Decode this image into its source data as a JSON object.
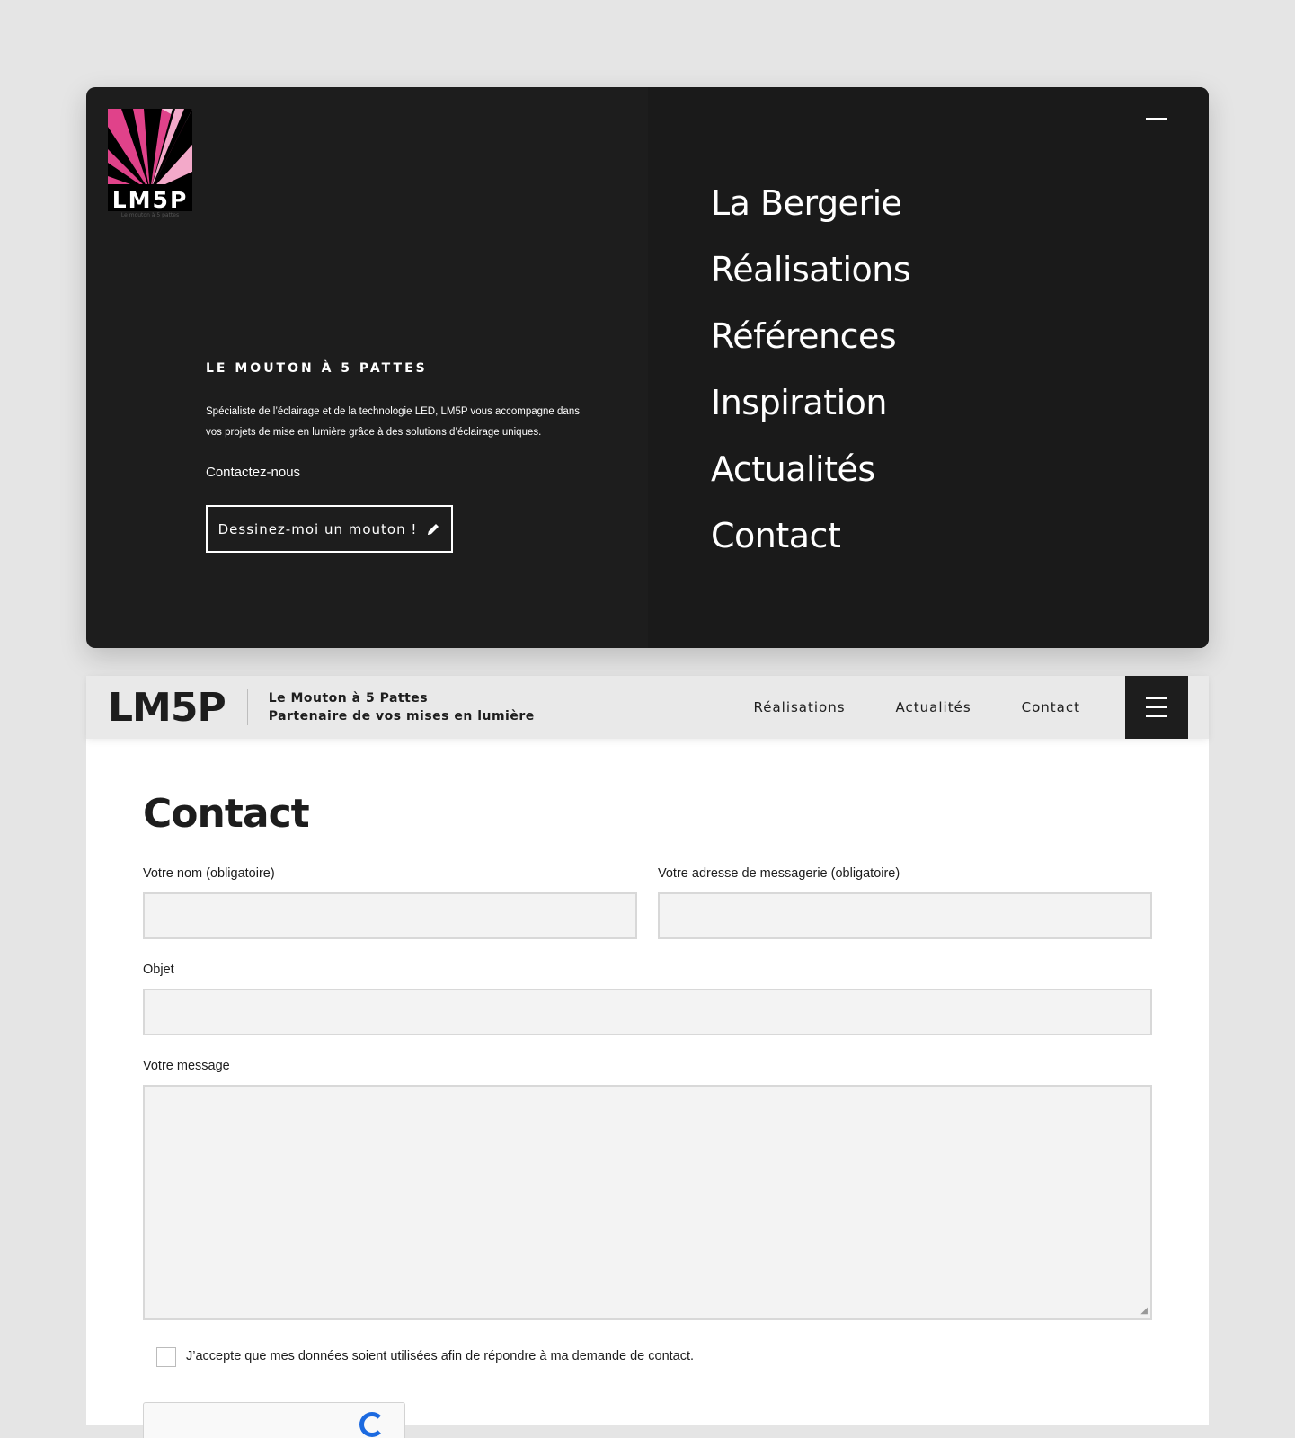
{
  "menu_overlay": {
    "logo": {
      "letters": "LM5P",
      "tag": "Le mouton à 5 pattes",
      "colors": [
        "#e0428a",
        "#f3a9c9",
        "#000000"
      ]
    },
    "brand_title": "LE MOUTON À 5 PATTES",
    "description": "Spécialiste de l’éclairage et de la technologie LED, LM5P vous accompagne dans vos projets de mise en lumière grâce à des solutions d’éclairage uniques.",
    "contact_link": "Contactez-nous",
    "cta_label": "Dessinez-moi un mouton !",
    "cta_icon": "pencil-icon",
    "close_icon": "close-icon",
    "nav_items": [
      "La Bergerie",
      "Réalisations",
      "Références",
      "Inspiration",
      "Actualités",
      "Contact"
    ]
  },
  "header": {
    "logo": "LM5P",
    "tagline_line1": "Le Mouton à 5 Pattes",
    "tagline_line2": "Partenaire de vos mises en lumière",
    "nav": [
      "Réalisations",
      "Actualités",
      "Contact"
    ],
    "menu_icon": "hamburger-icon"
  },
  "contact_form": {
    "title": "Contact",
    "name_label": "Votre nom (obligatoire)",
    "email_label": "Votre adresse de messagerie (obligatoire)",
    "subject_label": "Objet",
    "message_label": "Votre message",
    "name_value": "",
    "email_value": "",
    "subject_value": "",
    "message_value": "",
    "consent_text": "J’accepte que mes données soient utilisées afin de répondre à ma demande de contact.",
    "consent_checked": false
  },
  "colors": {
    "dark_panel": "#1d1d1d",
    "field_background": "#f3f3f3",
    "logo_pink": "#e0428a",
    "recaptcha_blue": "#1c6ae0"
  }
}
